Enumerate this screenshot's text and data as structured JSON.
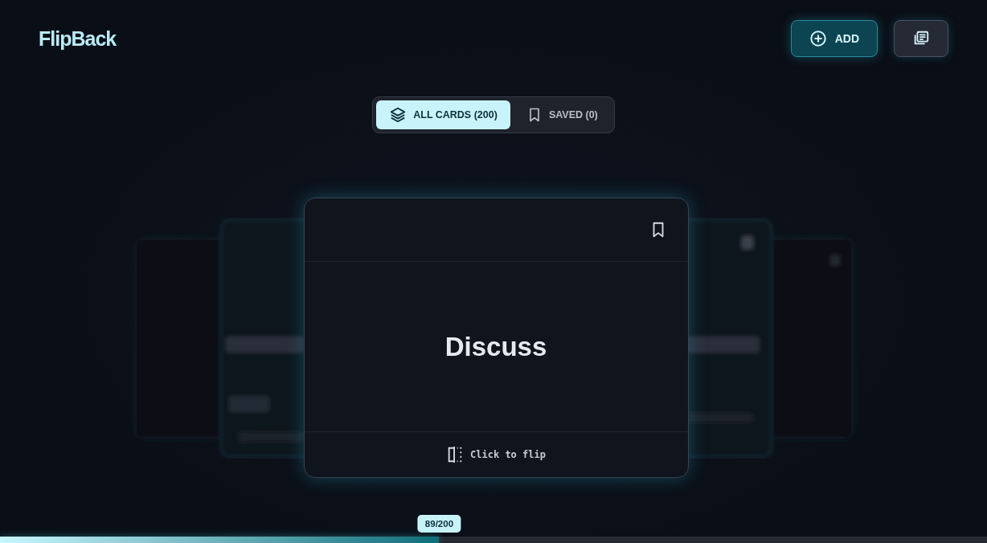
{
  "app": {
    "title": "FlipBack"
  },
  "header_actions": [
    {
      "kind": "add",
      "label": "ADD"
    },
    {
      "kind": "deck"
    }
  ],
  "filter_tabs": [
    {
      "kind": "all",
      "label": "ALL CARDS (200)",
      "selected": true
    },
    {
      "kind": "saved",
      "label": "SAVED (0)",
      "selected": false
    }
  ],
  "card": {
    "word": "Discuss",
    "hint": "Click to flip",
    "saved": false
  },
  "progress": {
    "label": "89/200",
    "level": 0.445
  }
}
